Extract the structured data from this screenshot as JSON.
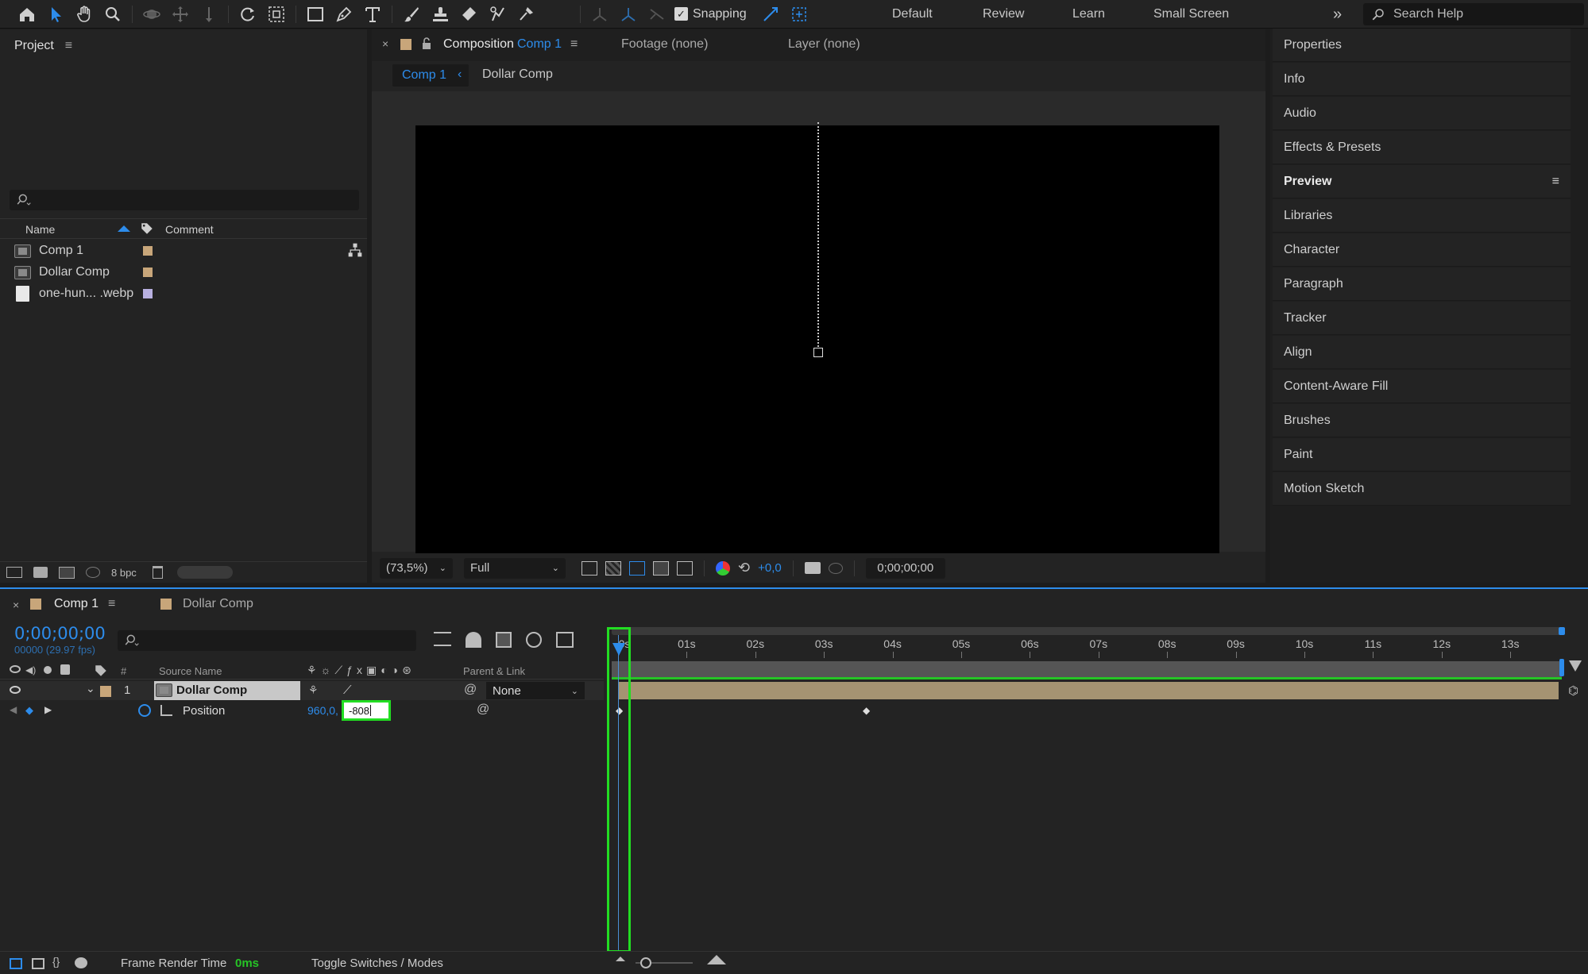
{
  "toolbar": {
    "tools": [
      "home-icon",
      "selection-tool-icon",
      "hand-tool-icon",
      "zoom-tool-icon",
      "orbit-camera-icon",
      "pan-camera-icon",
      "dolly-camera-icon",
      "rotate-tool-icon",
      "pan-behind-icon",
      "rectangle-tool-icon",
      "pen-tool-icon",
      "type-tool-icon",
      "brush-tool-icon",
      "clone-stamp-icon",
      "eraser-tool-icon",
      "roto-brush-icon",
      "puppet-pin-icon"
    ],
    "snapping_label": "Snapping",
    "workspaces": [
      "Default",
      "Review",
      "Learn",
      "Small Screen"
    ],
    "search_help": "Search Help"
  },
  "project": {
    "title": "Project",
    "col_name": "Name",
    "col_comment": "Comment",
    "items": [
      {
        "name": "Comp 1",
        "type": "comp",
        "color": "#c8a67a"
      },
      {
        "name": "Dollar Comp",
        "type": "comp",
        "color": "#c8a67a"
      },
      {
        "name": "one-hun... .webp",
        "type": "file",
        "color": "#b8b0e0"
      }
    ],
    "bpc": "8 bpc"
  },
  "composition": {
    "tab_label": "Composition",
    "tab_comp": "Comp 1",
    "footage_tab": "Footage (none)",
    "layer_tab": "Layer (none)",
    "breadcrumb_active": "Comp 1",
    "breadcrumb_next": "Dollar Comp",
    "zoom": "(73,5%)",
    "resolution": "Full",
    "exposure": "+0,0",
    "timecode": "0;00;00;00"
  },
  "right_panels": [
    "Properties",
    "Info",
    "Audio",
    "Effects & Presets",
    "Preview",
    "Libraries",
    "Character",
    "Paragraph",
    "Tracker",
    "Align",
    "Content-Aware Fill",
    "Brushes",
    "Paint",
    "Motion Sketch"
  ],
  "timeline": {
    "tab_active": "Comp 1",
    "tab_other": "Dollar Comp",
    "timecode": "0;00;00;00",
    "frames": "00000 (29.97 fps)",
    "col_num": "#",
    "col_source": "Source Name",
    "col_parent": "Parent & Link",
    "layer": {
      "index": "1",
      "name": "Dollar Comp",
      "parent": "None"
    },
    "property": {
      "name": "Position",
      "x_value": "960,0,",
      "y_input": "-808"
    },
    "ruler": [
      "0s",
      "01s",
      "02s",
      "03s",
      "04s",
      "05s",
      "06s",
      "07s",
      "08s",
      "09s",
      "10s",
      "11s",
      "12s",
      "13s"
    ],
    "frame_render_label": "Frame Render Time",
    "frame_render_value": "0ms",
    "toggle_label": "Toggle Switches / Modes"
  },
  "colors": {
    "accent": "#2d8ceb",
    "highlight": "#22dd22",
    "layer_bar": "#a59372"
  }
}
